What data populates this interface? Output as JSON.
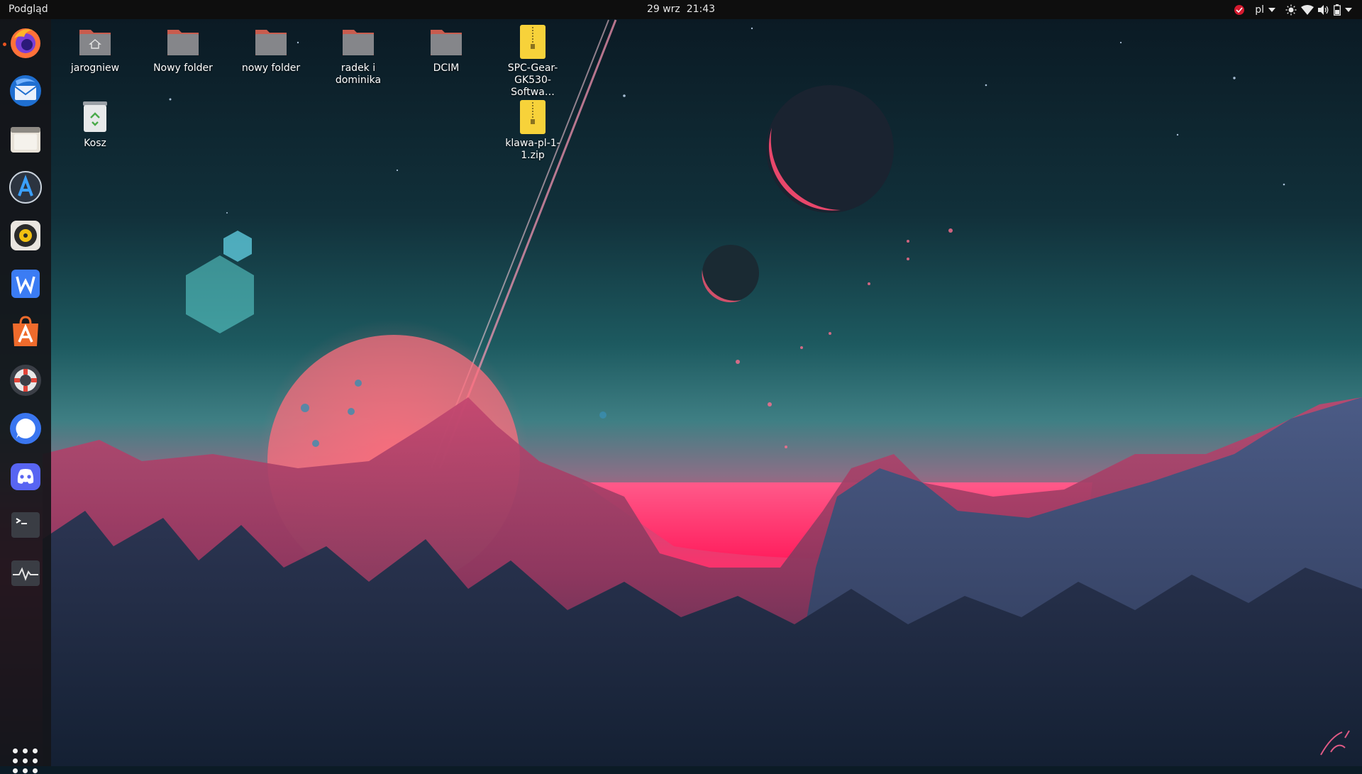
{
  "topbar": {
    "activities_label": "Podgląd",
    "date": "29 wrz",
    "time": "21:43",
    "keyboard_layout": "pl",
    "accent_color": "#e95420"
  },
  "dock": {
    "apps": [
      {
        "name": "Firefox",
        "icon": "firefox-icon",
        "running": true
      },
      {
        "name": "Thunderbird",
        "icon": "thunderbird-icon",
        "running": false
      },
      {
        "name": "Files",
        "icon": "files-icon",
        "running": false
      },
      {
        "name": "Arduino-like A app",
        "icon": "a-app-icon",
        "running": false
      },
      {
        "name": "Rhythmbox",
        "icon": "rhythmbox-icon",
        "running": false
      },
      {
        "name": "WPS Writer",
        "icon": "writer-icon",
        "running": false
      },
      {
        "name": "Ubuntu Software",
        "icon": "software-center-icon",
        "running": false
      },
      {
        "name": "Help",
        "icon": "help-lifebuoy-icon",
        "running": false
      },
      {
        "name": "Signal",
        "icon": "signal-icon",
        "running": false
      },
      {
        "name": "Discord",
        "icon": "discord-icon",
        "running": false
      },
      {
        "name": "Terminal",
        "icon": "terminal-icon",
        "running": false
      },
      {
        "name": "System Monitor",
        "icon": "system-monitor-icon",
        "running": false
      }
    ],
    "show_apps_icon": "show-applications-grid-icon"
  },
  "desktop": {
    "icons": [
      {
        "label": "jarogniew",
        "type": "home-folder"
      },
      {
        "label": "Nowy folder",
        "type": "folder"
      },
      {
        "label": "nowy folder",
        "type": "folder"
      },
      {
        "label": "radek i dominika",
        "type": "folder"
      },
      {
        "label": "DCIM",
        "type": "folder"
      },
      {
        "label": "SPC-Gear-GK530-Softwa…",
        "type": "zip"
      },
      {
        "label": "Kosz",
        "type": "trash"
      },
      {
        "label": "klawa-pl-1-1.zip",
        "type": "zip"
      }
    ]
  }
}
